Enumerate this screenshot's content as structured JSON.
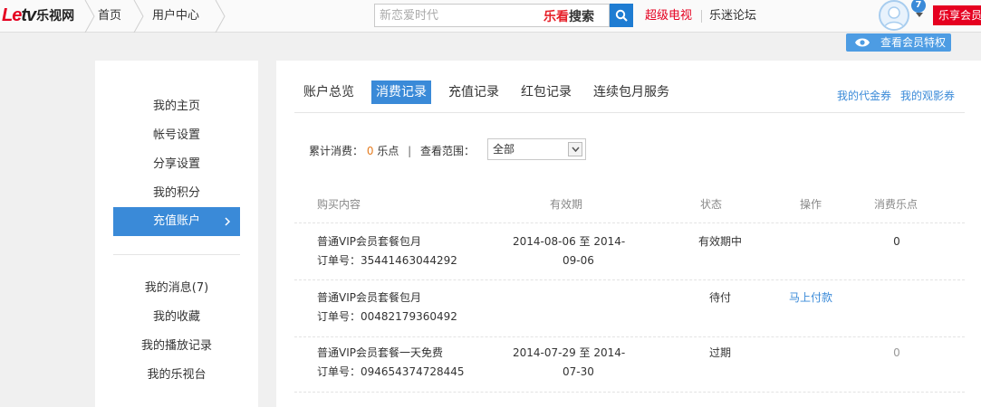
{
  "topbar": {
    "logo_le": "Le",
    "logo_tv": "tv",
    "logo_cn": "乐视网",
    "crumbs": [
      "首页",
      "用户中心"
    ],
    "search": {
      "placeholder": "新恋爱时代",
      "brand_a": "乐看",
      "brand_b": "搜索"
    },
    "nav": {
      "tv": "超级电视",
      "forum": "乐迷论坛"
    },
    "badge_count": "7",
    "vip_label": "乐享会员",
    "privilege_label": "查看会员特权",
    "colors": {
      "brand_red": "#e50020",
      "accent_blue": "#3a8ad8",
      "search_btn": "#1e7cd2"
    }
  },
  "sidebar": {
    "items": [
      {
        "label": "我的主页"
      },
      {
        "label": "帐号设置"
      },
      {
        "label": "分享设置"
      },
      {
        "label": "我的积分"
      },
      {
        "label": "充值账户",
        "active": true
      }
    ],
    "items2": [
      {
        "label": "我的消息(7)"
      },
      {
        "label": "我的收藏"
      },
      {
        "label": "我的播放记录"
      },
      {
        "label": "我的乐视台"
      }
    ]
  },
  "main": {
    "tabs": [
      {
        "label": "账户总览"
      },
      {
        "label": "消费记录",
        "active": true
      },
      {
        "label": "充值记录"
      },
      {
        "label": "红包记录"
      },
      {
        "label": "连续包月服务"
      }
    ],
    "tab_links": [
      "我的代金券",
      "我的观影券"
    ],
    "filter": {
      "total_label": "累计消费：",
      "total_value": "0",
      "total_unit": "乐点",
      "separator": "|",
      "range_label": "查看范围：",
      "range_value": "全部"
    },
    "table": {
      "headers": [
        "购买内容",
        "有效期",
        "状态",
        "操作",
        "消费乐点"
      ],
      "rows": [
        {
          "item": "普通VIP会员套餐包月",
          "order": "订单号：35441463044292",
          "period_1": "2014-08-06 至 2014-",
          "period_2": "09-06",
          "status": "有效期中",
          "action": "",
          "points": "0"
        },
        {
          "item": "普通VIP会员套餐包月",
          "order": "订单号：00482179360492",
          "period_1": "",
          "period_2": "",
          "status": "待付",
          "action": "马上付款",
          "points": ""
        },
        {
          "item": "普通VIP会员套餐一天免费",
          "order": "订单号：094654374728445",
          "period_1": "2014-07-29 至 2014-",
          "period_2": "07-30",
          "status": "过期",
          "action": "",
          "points": "0"
        }
      ]
    }
  }
}
